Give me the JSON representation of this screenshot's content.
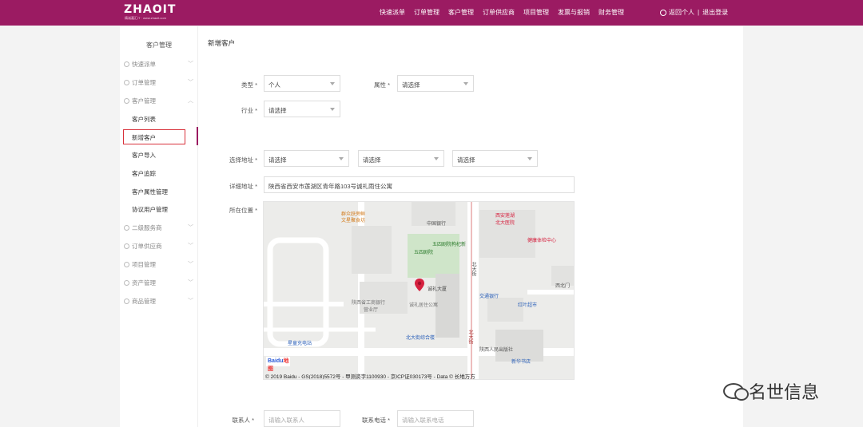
{
  "header": {
    "logo": "ZHAOIT",
    "logo_sub": "精诚嘉汇IT · www.zhaoit.com",
    "nav": [
      "快速派单",
      "订单管理",
      "客户管理",
      "订单供应商",
      "项目管理",
      "发票与报销",
      "财务管理"
    ],
    "back_personal": "返回个人",
    "separator": "|",
    "logout": "退出登录"
  },
  "sidebar": {
    "title": "客户管理",
    "groups": [
      {
        "label": "快速派单"
      },
      {
        "label": "订单管理"
      },
      {
        "label": "客户管理"
      }
    ],
    "sub_items": [
      "客户列表",
      "新增客户",
      "客户导入",
      "客户追踪",
      "客户属性管理",
      "协议用户管理"
    ],
    "groups_after": [
      {
        "label": "二级服务商"
      },
      {
        "label": "订单供应商"
      },
      {
        "label": "项目管理"
      },
      {
        "label": "资产管理"
      },
      {
        "label": "商品管理"
      }
    ]
  },
  "main": {
    "title": "新增客户",
    "type_label": "类型 *",
    "type_value": "个人",
    "attr_label": "属性 *",
    "attr_value": "请选择",
    "industry_label": "行业 *",
    "industry_value": "请选择",
    "address_label": "选择地址 *",
    "province_value": "请选择",
    "city_value": "请选择",
    "district_value": "请选择",
    "detail_label": "详细地址 *",
    "detail_value": "陕西省西安市莲湖区青年路103号诚礼雨住公寓",
    "location_label": "所在位置 *",
    "contact_label": "联系人 *",
    "contact_placeholder": "请输入联系人",
    "phone_label": "联系电话 *",
    "phone_placeholder": "请输入联系电话"
  },
  "map": {
    "labels": [
      "群众跃旁鲜",
      "文星聚食坊",
      "中国银行",
      "西安莲湖",
      "北大医院",
      "五四剧院枸杞新",
      "五四剧院",
      "健康体检中心",
      "诚礼大厦",
      "西北门",
      "陕西省工商银行",
      "营业厅",
      "诚礼居住公寓",
      "交通银行",
      "红叶超市",
      "星童充电站",
      "北大街综合楼",
      "陕西人民出版社",
      "新华书店",
      "北大街",
      "北大街"
    ],
    "logo": "Baidu",
    "logo_suffix": "地图",
    "copyright": "© 2019 Baidu - GS(2018)5572号 - 甲测资字1100930 - 京ICP证030173号 - Data © 长地万方"
  },
  "watermark": "名世信息",
  "colors": {
    "brand": "#9b1b62",
    "highlight": "#d8323b",
    "pin": "#d6213f"
  }
}
